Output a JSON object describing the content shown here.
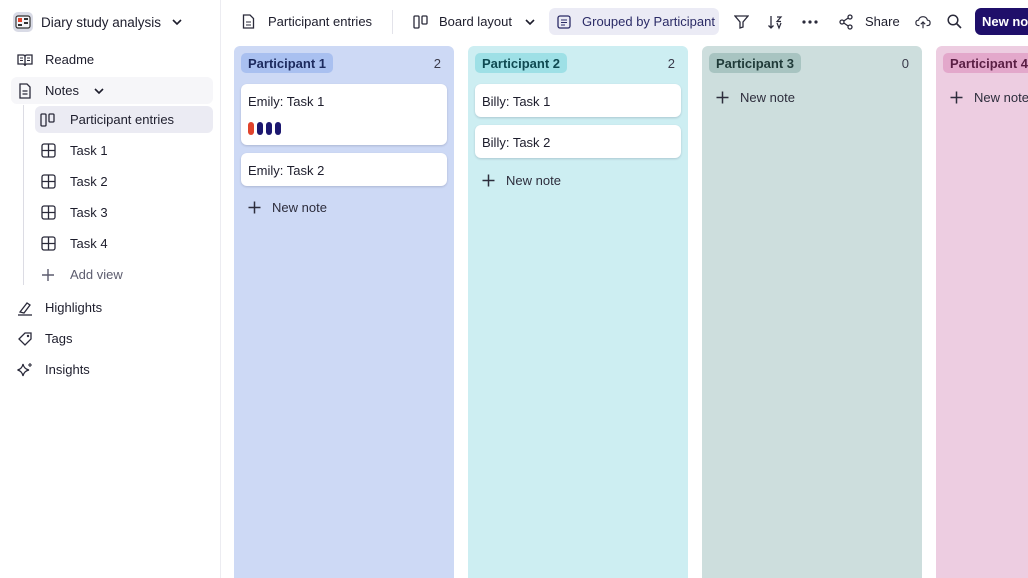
{
  "project": {
    "title": "Diary study analysis"
  },
  "sidebar": {
    "readme": "Readme",
    "notes": "Notes",
    "views": [
      {
        "label": "Participant entries",
        "icon": "board-icon"
      },
      {
        "label": "Task 1",
        "icon": "table-icon"
      },
      {
        "label": "Task 2",
        "icon": "table-icon"
      },
      {
        "label": "Task 3",
        "icon": "table-icon"
      },
      {
        "label": "Task 4",
        "icon": "table-icon"
      }
    ],
    "add_view": "Add view",
    "highlights": "Highlights",
    "tags": "Tags",
    "insights": "Insights"
  },
  "toolbar": {
    "view_name": "Participant entries",
    "layout": "Board layout",
    "grouping": "Grouped by Participant",
    "share": "Share",
    "new_button": "New note"
  },
  "colors": {
    "accent": "#1f0f6a",
    "column_1_bg": "#cdd9f5",
    "column_1_pill": "#a9c0f0",
    "column_2_bg": "#cdeef2",
    "column_2_pill": "#9ee0e6",
    "column_3_bg": "#cddedd",
    "column_3_pill": "#a8c4c1",
    "column_4_bg": "#edcde1",
    "column_4_pill": "#e3a8cb",
    "tag_red": "#e0432c",
    "tag_navy": "#1c1870"
  },
  "board": {
    "columns": [
      {
        "name": "Participant 1",
        "count": "2",
        "cards": [
          "Emily: Task 1",
          "Emily: Task 2"
        ]
      },
      {
        "name": "Participant 2",
        "count": "2",
        "cards": [
          "Billy: Task 1",
          "Billy: Task 2"
        ]
      },
      {
        "name": "Participant 3",
        "count": "0",
        "cards": []
      },
      {
        "name": "Participant 4",
        "count": "",
        "cards": []
      }
    ],
    "new_note_label": "New note"
  }
}
